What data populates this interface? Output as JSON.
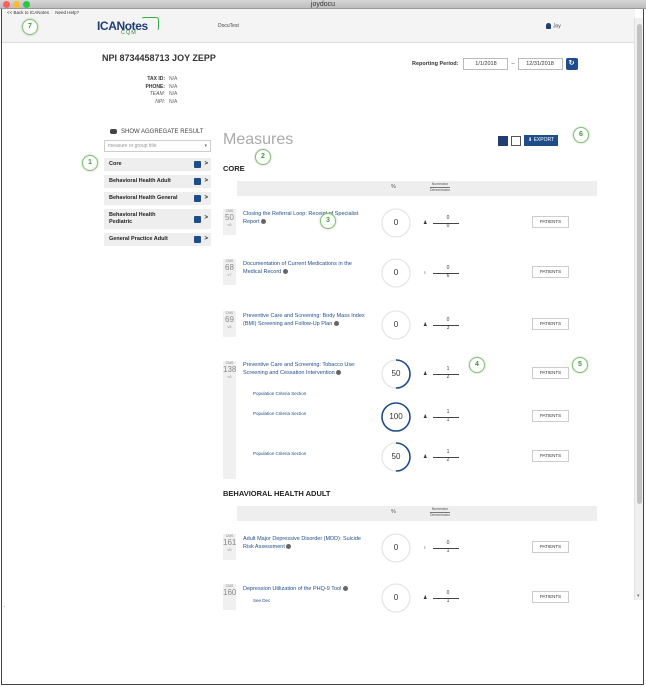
{
  "window": {
    "title": "joydocu"
  },
  "colors": {
    "accent": "#1f4d8a",
    "navy": "#1f3f73",
    "callout_green": "#7cc46d",
    "logo_green": "#39a84a"
  },
  "topnav": {
    "back_link": "<< Back to ICANotes",
    "help_link": "Need Help?",
    "logo_main": "ICANotes",
    "logo_sub": "CQM",
    "app_name": "DocuTest",
    "user_name": "Joy"
  },
  "provider": {
    "npi_title": "NPI 8734458713 JOY ZEPP",
    "fields": [
      {
        "key": "TAX ID:",
        "value": "N/A",
        "italic": false
      },
      {
        "key": "PHONE:",
        "value": "N/A",
        "italic": false
      },
      {
        "key": "TEAM:",
        "value": "N/A",
        "italic": true
      },
      {
        "key": "NPI:",
        "value": "N/A",
        "italic": true
      }
    ]
  },
  "reporting": {
    "label": "Reporting Period:",
    "start": "1/1/2018",
    "end": "12/31/2018",
    "dash": "–"
  },
  "sidebar": {
    "aggregate_label": "SHOW AGGREGATE RESULT",
    "search_placeholder": "measure or group title",
    "items": [
      {
        "label": "Core"
      },
      {
        "label": "Behavioral Health Adult"
      },
      {
        "label": "Behavioral Health General"
      },
      {
        "label": "Behavioral Health Pediatric"
      },
      {
        "label": "General Practice Adult"
      }
    ]
  },
  "main": {
    "title": "Measures",
    "export_label": "EXPORT",
    "table_header": {
      "pct": "%",
      "numerator": "Numerator",
      "denominator": "Denominator"
    },
    "sections": [
      {
        "name": "CORE"
      },
      {
        "name": "BEHAVIORAL HEALTH ADULT"
      }
    ],
    "measures": [
      {
        "cms_label": "CMS",
        "cms": "50",
        "version": "v6",
        "title": "Closing the Referral Loop: Receipt of Specialist Report",
        "pct": "0",
        "pct_value": 0,
        "num": "0",
        "den": "0",
        "icon": "person-icon",
        "button": "PATIENTS"
      },
      {
        "cms_label": "CMS",
        "cms": "68",
        "version": "v7",
        "title": "Documentation of Current Medications in the Medical Record",
        "pct": "0",
        "pct_value": 0,
        "num": "0",
        "den": "6",
        "icon": "stethoscope-icon",
        "button": "PATIENTS"
      },
      {
        "cms_label": "CMS",
        "cms": "69",
        "version": "v6",
        "title": "Preventive Care and Screening: Body Mass Index (BMI) Screening and Follow-Up Plan",
        "pct": "0",
        "pct_value": 0,
        "num": "0",
        "den": "3",
        "icon": "person-icon",
        "button": "PATIENTS"
      },
      {
        "cms_label": "CMS",
        "cms": "138",
        "version": "v6",
        "title": "Preventive Care and Screening: Tobacco Use: Screening and Cessation Intervention",
        "pct": "50",
        "pct_value": 50,
        "num": "1",
        "den": "2",
        "icon": "person-icon",
        "button": "PATIENTS",
        "first_population": "Population Criteria Section"
      },
      {
        "population": "Population Criteria Section",
        "pct": "100",
        "pct_value": 100,
        "num": "1",
        "den": "1",
        "icon": "person-icon",
        "button": "PATIENTS"
      },
      {
        "population": "Population Criteria Section",
        "pct": "50",
        "pct_value": 50,
        "num": "1",
        "den": "2",
        "icon": "person-icon",
        "button": "PATIENTS"
      },
      {
        "cms_label": "CMS",
        "cms": "161",
        "version": "v6",
        "title": "Adult Major Depressive Disorder (MDD): Suicide Risk Assessment",
        "pct": "0",
        "pct_value": 0,
        "num": "0",
        "den": "1",
        "icon": "stethoscope-icon",
        "button": "PATIENTS"
      },
      {
        "cms_label": "CMS",
        "cms": "160",
        "title": "Depression Utilization of the PHQ-9 Tool",
        "sub": "See Dec",
        "pct": "0",
        "pct_value": 0,
        "num": "0",
        "den": "1",
        "icon": "person-icon",
        "button": "PATIENTS"
      }
    ]
  },
  "callouts": [
    "1",
    "2",
    "3",
    "4",
    "5",
    "6",
    "7"
  ]
}
